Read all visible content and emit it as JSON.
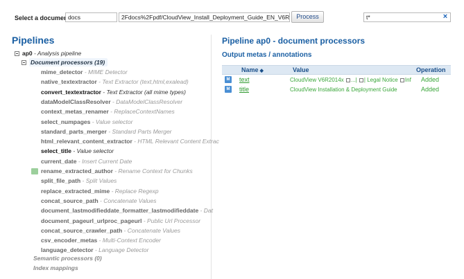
{
  "toolbar": {
    "select_label": "Select a document",
    "source_value": "docs",
    "path_value": "2Fdocs%2Fpdf/CloudView_Install_Deployment_Guide_EN_V6R2014x.pdf",
    "process_label": "Process",
    "filter_value": "t*",
    "clear_icon": "×"
  },
  "left": {
    "title": "Pipelines",
    "pipeline": {
      "name": "ap0",
      "sep": " - ",
      "desc": "Analysis pipeline"
    },
    "group": {
      "label": "Document processors (19)"
    },
    "processors": [
      {
        "name": "mime_detector",
        "desc": "MIME Detector",
        "active": false
      },
      {
        "name": "native_textextractor",
        "desc": "Text Extractor (text,html,exalead)",
        "active": false
      },
      {
        "name": "convert_textextractor",
        "desc": "Text Extractor (all mime types)",
        "active": true
      },
      {
        "name": "dataModelClassResolver",
        "desc": "DataModelClassResolver",
        "active": false
      },
      {
        "name": "context_metas_renamer",
        "desc": "ReplaceContextNames",
        "active": false
      },
      {
        "name": "select_numpages",
        "desc": "Value selector",
        "active": false
      },
      {
        "name": "standard_parts_merger",
        "desc": "Standard Parts Merger",
        "active": false
      },
      {
        "name": "html_relevant_content_extractor",
        "desc": "HTML Relevant Content Extrac",
        "active": false
      },
      {
        "name": "select_title",
        "desc": "Value selector",
        "active": true
      },
      {
        "name": "current_date",
        "desc": "Insert Current Date",
        "active": false
      },
      {
        "name": "rename_extracted_author",
        "desc": "Rename Context for Chunks",
        "active": false,
        "badge": true
      },
      {
        "name": "split_file_path",
        "desc": "Split Values",
        "active": false
      },
      {
        "name": "replace_extracted_mime",
        "desc": "Replace Regexp",
        "active": false
      },
      {
        "name": "concat_source_path",
        "desc": "Concatenate Values",
        "active": false
      },
      {
        "name": "document_lastmodifieddate_formatter_lastmodifieddate",
        "desc": "Dat",
        "active": false
      },
      {
        "name": "document_pageurl_urlproc_pageurl",
        "desc": "Public Url Processor",
        "active": false
      },
      {
        "name": "concat_source_crawler_path",
        "desc": "Concatenate Values",
        "active": false
      },
      {
        "name": "csv_encoder_metas",
        "desc": "Multi-Context Encoder",
        "active": false
      },
      {
        "name": "language_detector",
        "desc": "Language Detector",
        "active": false
      }
    ],
    "separator": " - ",
    "semantic_label": "Semantic processors (0)",
    "index_label": "Index mappings"
  },
  "right": {
    "title": "Pipeline ap0 - document processors",
    "subtitle": "Output metas / annotations",
    "columns": {
      "name": "Name",
      "sort_icon": "◆",
      "value": "Value",
      "operation": "Operation"
    },
    "rows": [
      {
        "icon": "M",
        "name": "text",
        "value_prefix": "CloudView V6R2014x",
        "value_mid": "...|",
        "value_mid2": "| Legal Notice",
        "value_suffix": "Inf",
        "operation": "Added"
      },
      {
        "icon": "M",
        "name": "title",
        "value_prefix": "CloudView Installation & Deployment Guide",
        "operation": "Added"
      }
    ]
  },
  "colors": {
    "accent": "#1a5fa3",
    "added": "#3aa63a",
    "meta_icon": "#4a8fd4"
  }
}
